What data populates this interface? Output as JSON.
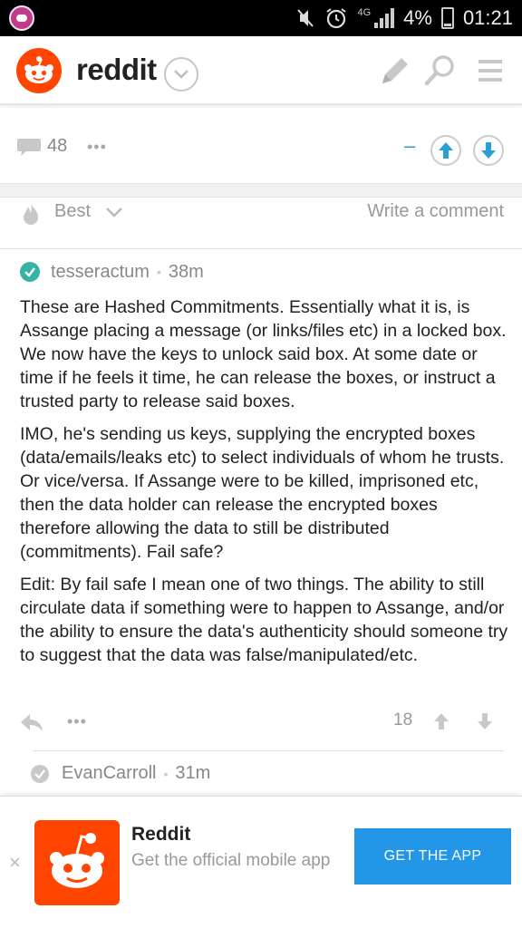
{
  "status_bar": {
    "network": "4G",
    "battery": "4%",
    "time": "01:21"
  },
  "header": {
    "app_name": "reddit"
  },
  "post_actions": {
    "comment_count": "48",
    "more": "•••",
    "minus": "–"
  },
  "sort": {
    "label": "Best",
    "write_comment": "Write a comment"
  },
  "comment": {
    "author": "tesseractum",
    "separator": "•",
    "age": "38m",
    "paragraphs": [
      "These are Hashed Commitments. Essentially what it is, is Assange placing a message (or links/files etc) in a locked box. We now have the keys to unlock said box. At some date or time if he feels it time, he can release the boxes, or instruct a trusted party to release said boxes.",
      "IMO, he's sending us keys, supplying the encrypted boxes (data/emails/leaks etc) to select individuals of whom he trusts. Or vice/versa. If Assange were to be killed, imprisoned etc, then the data holder can release the encrypted boxes therefore allowing the data to still be distributed (commitments). Fail safe?",
      "Edit: By fail safe I mean one of two things. The ability to still circulate data if something were to happen to Assange, and/or the ability to ensure the data's authenticity should someone try to suggest that the data was false/manipulated/etc."
    ],
    "more": "•••",
    "score": "18"
  },
  "child_comment": {
    "author": "EvanCarroll",
    "separator": "•",
    "age": "31m"
  },
  "banner": {
    "close": "×",
    "title": "Reddit",
    "subtitle": "Get the official mobile app",
    "cta": "GET THE APP"
  },
  "colors": {
    "brand": "#ff4500",
    "accent_blue": "#2a9fd6",
    "cta_blue": "#2496e8",
    "check_green": "#35b4a6"
  }
}
